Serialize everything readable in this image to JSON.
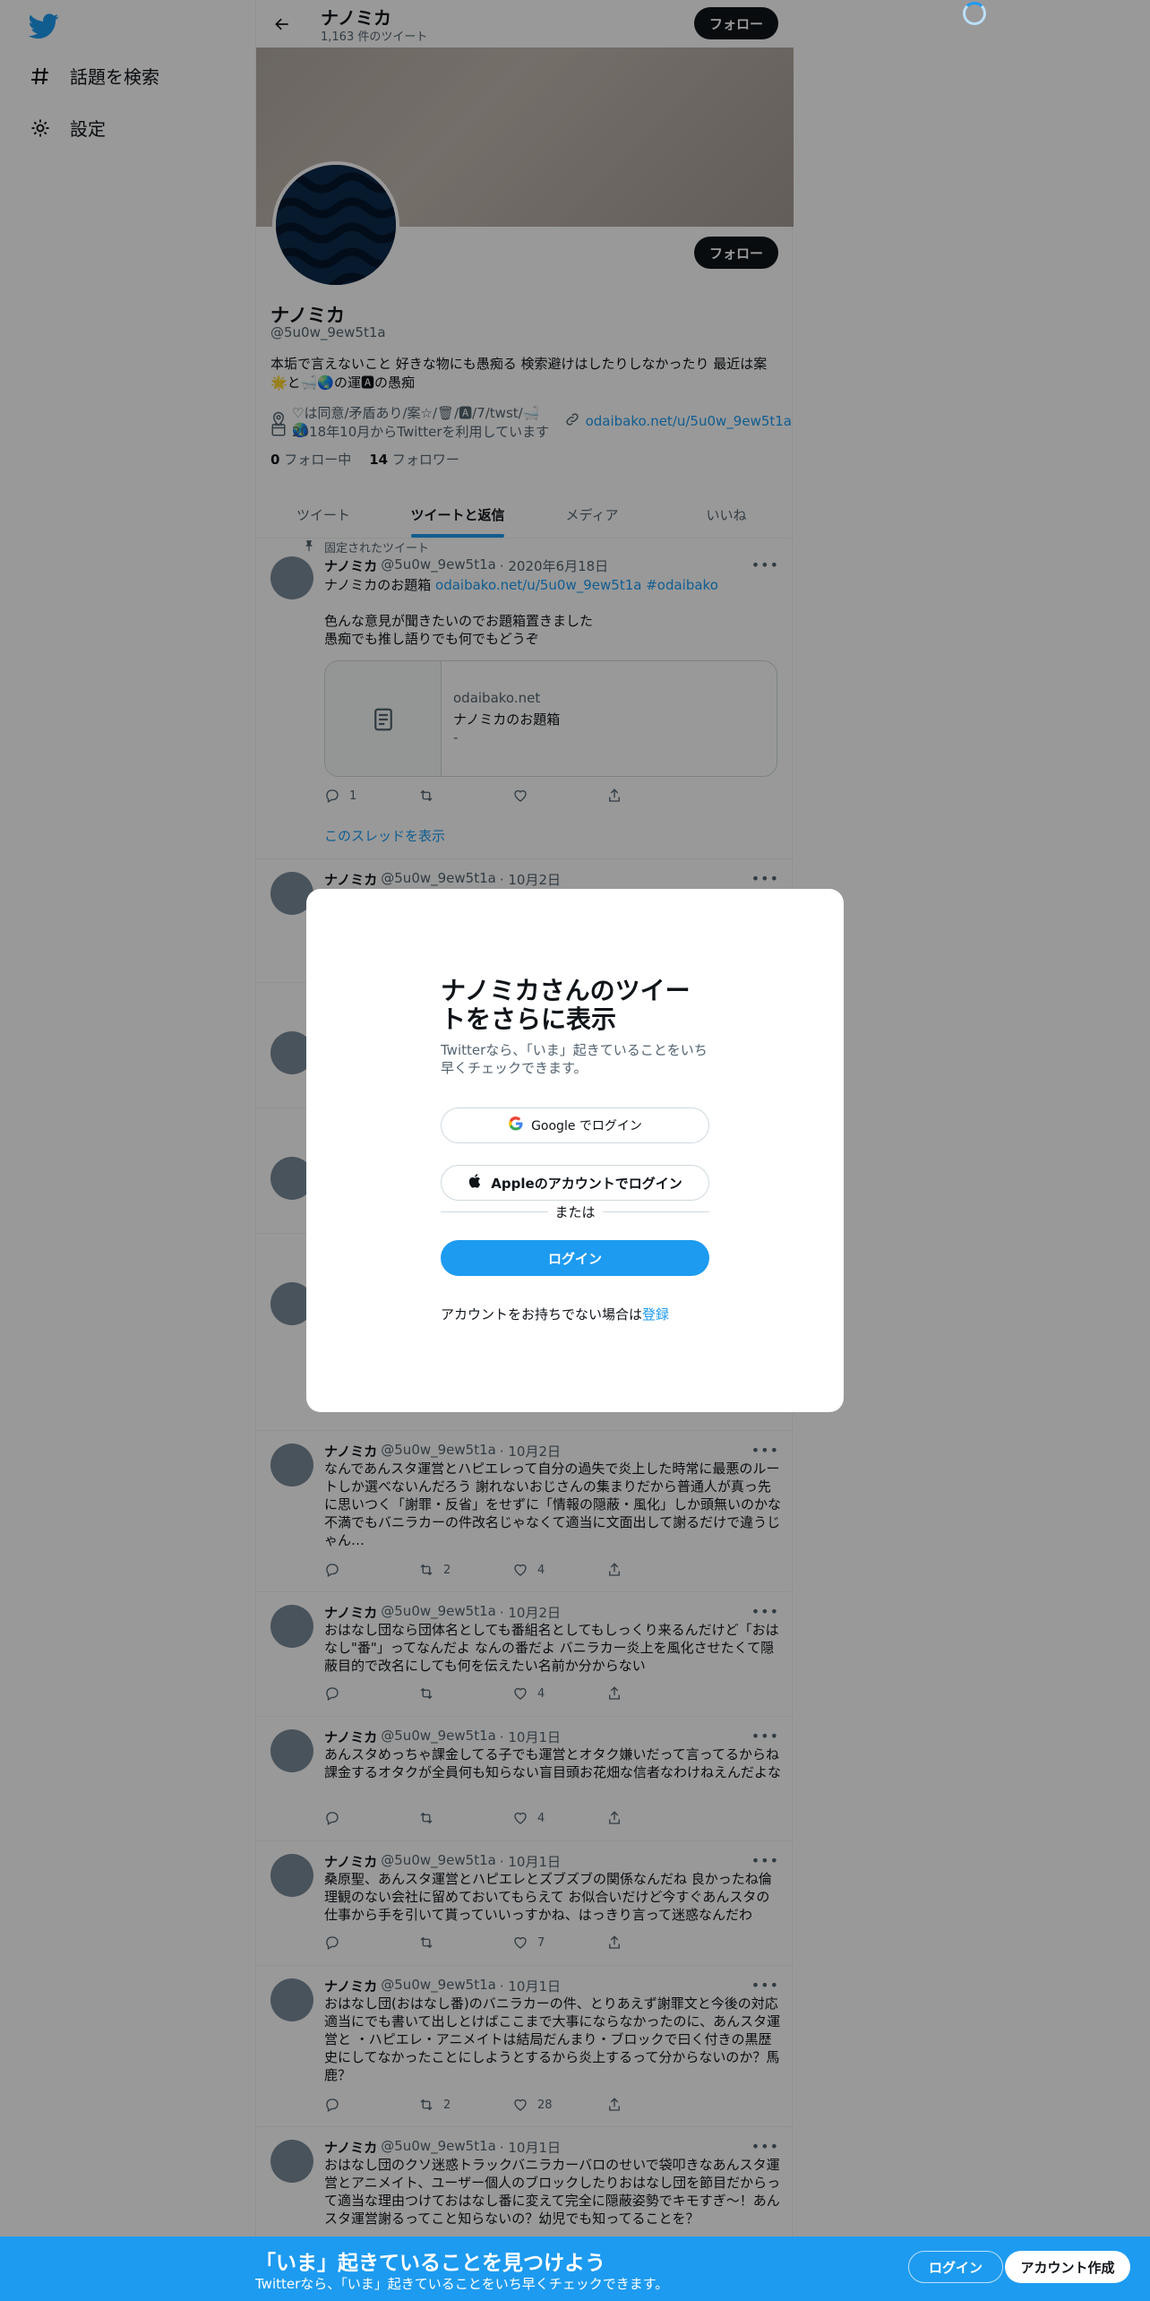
{
  "sidebar": {
    "explore_label": "話題を検索",
    "settings_label": "設定"
  },
  "header": {
    "name": "ナノミカ",
    "tweet_count": "1,163 件のツイート",
    "follow_label": "フォロー"
  },
  "profile": {
    "name": "ナノミカ",
    "handle": "@5u0w_9ew5t1a",
    "bio": "本垢で言えないこと 好きな物にも愚痴る 検索避けはしたりしなかったり 最近は案🌟と🛁🌏の運🅰の愚痴",
    "location": "♡は同意/矛盾あり/案☆/🗑/🅰/7/twst/🛁🌏",
    "url": "odaibako.net/u/5u0w_9ew5t1a",
    "joined": "2018年10月からTwitterを利用しています",
    "following_count": "0",
    "following_label": "フォロー中",
    "followers_count": "14",
    "followers_label": "フォロワー",
    "follow_label": "フォロー"
  },
  "tabs": [
    "ツイート",
    "ツイートと返信",
    "メディア",
    "いいね"
  ],
  "pinned": {
    "label": "固定されたツイート",
    "name": "ナノミカ",
    "handle": "@5u0w_9ew5t1a",
    "date": "· 2020年6月18日",
    "text_plain": "ナノミカのお題箱 ",
    "text_link": "odaibako.net/u/5u0w_9ew5t1a #odaibako",
    "text2": "色んな意見が聞きたいのでお題箱置きました",
    "text3": "愚痴でも推し語りでも何でもどうぞ",
    "card_domain": "odaibako.net",
    "card_title": "ナノミカのお題箱",
    "card_desc": "-",
    "replies": "1",
    "thread_link": "このスレッドを表示"
  },
  "tweets": [
    {
      "name": "ナノミカ",
      "handle": "@5u0w_9ew5t1a",
      "date": "· 10月2日",
      "text": "",
      "replies": "",
      "retweets": "",
      "likes": ""
    },
    {
      "name": "ナノミカ",
      "handle": "@5u0w_9ew5t1a",
      "date": "· 10月2日",
      "text": "なんであんスタ運営とハピエレって自分の過失で炎上した時常に最悪のルートしか選べないんだろう 謝れないおじさんの集まりだから普通人が真っ先に思いつく「謝罪・反省」をせずに「情報の隠蔽・風化」しか頭無いのかな 不満でもバニラカーの件改名じゃなくて適当に文面出して謝るだけで違うじゃん…",
      "replies": "",
      "retweets": "2",
      "likes": "4"
    },
    {
      "name": "ナノミカ",
      "handle": "@5u0w_9ew5t1a",
      "date": "· 10月2日",
      "text": "おはなし団なら団体名としても番組名としてもしっくり来るんだけど「おはなし\"番\"」ってなんだよ なんの番だよ バニラカー炎上を風化させたくて隠蔽目的で改名にしても何を伝えたい名前か分からない",
      "replies": "",
      "retweets": "",
      "likes": "4"
    },
    {
      "name": "ナノミカ",
      "handle": "@5u0w_9ew5t1a",
      "date": "· 10月1日",
      "text": "あんスタめっちゃ課金してる子でも運営とオタク嫌いだって言ってるからね 課金するオタクが全員何も知らない盲目頭お花畑な信者なわけねえんだよな",
      "replies": "",
      "retweets": "",
      "likes": "4"
    },
    {
      "name": "ナノミカ",
      "handle": "@5u0w_9ew5t1a",
      "date": "· 10月1日",
      "text": "桑原聖、あんスタ運営とハピエレとズブズブの関係なんだね 良かったね倫理観のない会社に留めておいてもらえて お似合いだけど今すぐあんスタの仕事から手を引いて貰っていいっすかね、はっきり言って迷惑なんだわ",
      "replies": "",
      "retweets": "",
      "likes": "7"
    },
    {
      "name": "ナノミカ",
      "handle": "@5u0w_9ew5t1a",
      "date": "· 10月1日",
      "text": "おはなし団(おはなし番)のバニラカーの件、とりあえず謝罪文と今後の対応適当にでも書いて出しとけばここまで大事にならなかったのに、あんスタ運営と ・ハピエレ・アニメイトは結局だんまり・ブロックで曰く付きの黒歴史にしてなかったことにしようとするから炎上するって分からないのか？馬鹿？",
      "replies": "",
      "retweets": "2",
      "likes": "28"
    },
    {
      "name": "ナノミカ",
      "handle": "@5u0w_9ew5t1a",
      "date": "· 10月1日",
      "text": "おはなし団のクソ迷惑トラックバニラカーバロのせいで袋叩きなあんスタ運営とアニメイト、ユーザー個人のブロックしたりおはなし団を節目だからって適当な理由つけておはなし番に変えて完全に隠蔽姿勢でキモすぎ〜！あんスタ運営謝るってこと知らないの？幼児でも知ってることを？",
      "replies": "",
      "retweets": "",
      "likes": ""
    }
  ],
  "modal": {
    "title": "ナノミカさんのツイートをさらに表示",
    "subtitle": "Twitterなら、「いま」起きていることをいち早くチェックできます。",
    "google_label": "Google でログイン",
    "apple_label": "Appleのアカウントでログイン",
    "or_label": "または",
    "login_label": "ログイン",
    "no_account_text": "アカウントをお持ちでない場合は",
    "signup_link": "登録"
  },
  "bottom_bar": {
    "title": "「いま」起きていることを見つけよう",
    "subtitle": "Twitterなら、「いま」起きていることをいち早くチェックできます。",
    "login_label": "ログイン",
    "signup_label": "アカウント作成"
  },
  "colors": {
    "accent": "#1d9bf0",
    "text": "#0f1419",
    "secondary": "#536471"
  }
}
